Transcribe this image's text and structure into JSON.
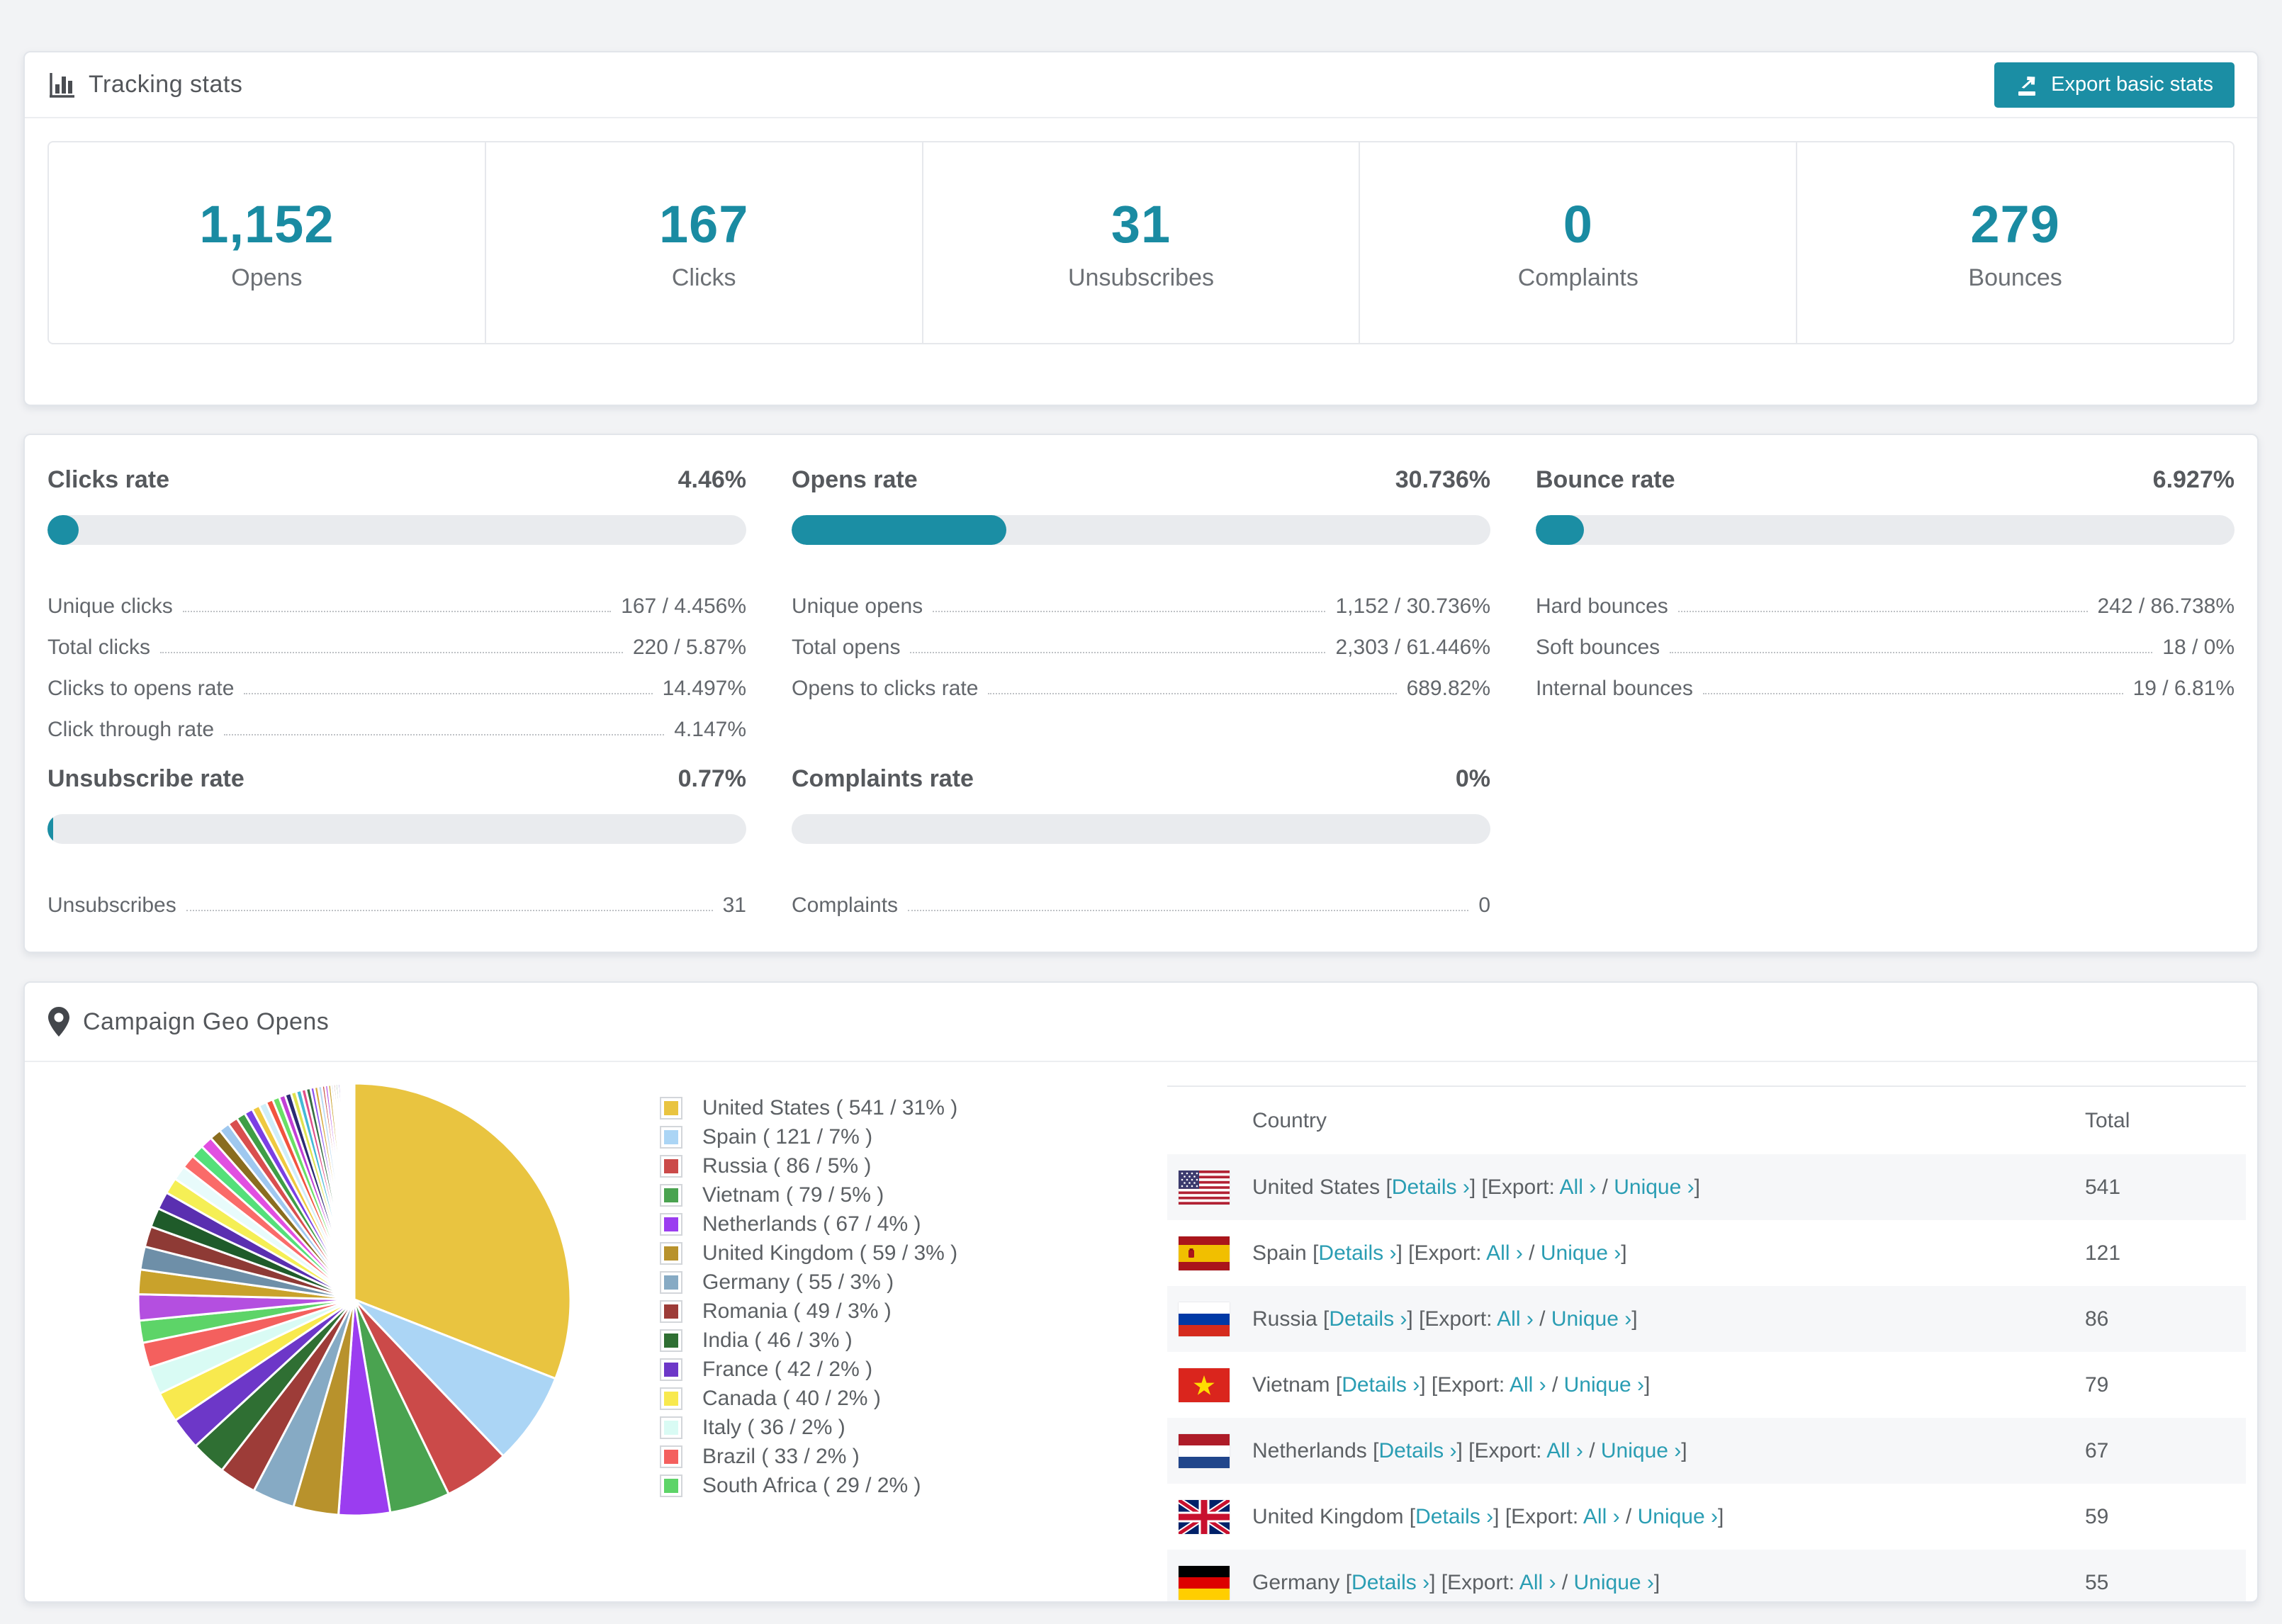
{
  "colors": {
    "accent_teal": "#1b8ea4",
    "number_teal": "#1a8ba2",
    "link_teal": "#2a9db3",
    "bar_track": "#e9ebee"
  },
  "tracking": {
    "title": "Tracking stats",
    "export_button": "Export basic stats",
    "stats": [
      {
        "value": "1,152",
        "label": "Opens"
      },
      {
        "value": "167",
        "label": "Clicks"
      },
      {
        "value": "31",
        "label": "Unsubscribes"
      },
      {
        "value": "0",
        "label": "Complaints"
      },
      {
        "value": "279",
        "label": "Bounces"
      }
    ]
  },
  "rates": {
    "cards": [
      {
        "title": "Clicks rate",
        "value": "4.46%",
        "percent": 4.46,
        "rows": [
          {
            "label": "Unique clicks",
            "value": "167 / 4.456%"
          },
          {
            "label": "Total clicks",
            "value": "220 / 5.87%"
          },
          {
            "label": "Clicks to opens rate",
            "value": "14.497%"
          },
          {
            "label": "Click through rate",
            "value": "4.147%"
          }
        ]
      },
      {
        "title": "Opens rate",
        "value": "30.736%",
        "percent": 30.736,
        "rows": [
          {
            "label": "Unique opens",
            "value": "1,152 / 30.736%"
          },
          {
            "label": "Total opens",
            "value": "2,303 / 61.446%"
          },
          {
            "label": "Opens to clicks rate",
            "value": "689.82%"
          }
        ]
      },
      {
        "title": "Bounce rate",
        "value": "6.927%",
        "percent": 6.927,
        "rows": [
          {
            "label": "Hard bounces",
            "value": "242 / 86.738%"
          },
          {
            "label": "Soft bounces",
            "value": "18 / 0%"
          },
          {
            "label": "Internal bounces",
            "value": "19 / 6.81%"
          }
        ]
      },
      {
        "title": "Unsubscribe rate",
        "value": "0.77%",
        "percent": 0.77,
        "rows": [
          {
            "label": "Unsubscribes",
            "value": "31"
          }
        ]
      },
      {
        "title": "Complaints rate",
        "value": "0%",
        "percent": 0,
        "rows": [
          {
            "label": "Complaints",
            "value": "0"
          }
        ]
      }
    ]
  },
  "geo": {
    "title": "Campaign Geo Opens",
    "table": {
      "headers": {
        "country": "Country",
        "total": "Total"
      },
      "link_details": "Details ›",
      "export_prefix": "[Export:",
      "link_all": "All ›",
      "slash": "/",
      "link_unique": "Unique ›",
      "bracket_open": "[",
      "bracket_close": "]",
      "rows": [
        {
          "country": "United States",
          "total": "541",
          "flag": "us"
        },
        {
          "country": "Spain",
          "total": "121",
          "flag": "es"
        },
        {
          "country": "Russia",
          "total": "86",
          "flag": "ru"
        },
        {
          "country": "Vietnam",
          "total": "79",
          "flag": "vn"
        },
        {
          "country": "Netherlands",
          "total": "67",
          "flag": "nl"
        },
        {
          "country": "United Kingdom",
          "total": "59",
          "flag": "gb"
        },
        {
          "country": "Germany",
          "total": "55",
          "flag": "de"
        }
      ]
    }
  },
  "chart_data": {
    "type": "pie",
    "title": "Campaign Geo Opens",
    "legend_position": "right",
    "start_angle_deg": -90,
    "direction": "clockwise",
    "series": [
      {
        "name": "United States",
        "value": 541,
        "pct": "31%",
        "color": "#e9c440",
        "legend": "United States ( 541 / 31% )"
      },
      {
        "name": "Spain",
        "value": 121,
        "pct": "7%",
        "color": "#abd5f5",
        "legend": "Spain ( 121 / 7% )"
      },
      {
        "name": "Russia",
        "value": 86,
        "pct": "5%",
        "color": "#cb4a49",
        "legend": "Russia ( 86 / 5% )"
      },
      {
        "name": "Vietnam",
        "value": 79,
        "pct": "5%",
        "color": "#4aa350",
        "legend": "Vietnam ( 79 / 5% )"
      },
      {
        "name": "Netherlands",
        "value": 67,
        "pct": "4%",
        "color": "#9b3df0",
        "legend": "Netherlands ( 67 / 4% )"
      },
      {
        "name": "United Kingdom",
        "value": 59,
        "pct": "3%",
        "color": "#b8922c",
        "legend": "United Kingdom ( 59 / 3% )"
      },
      {
        "name": "Germany",
        "value": 55,
        "pct": "3%",
        "color": "#86aac4",
        "legend": "Germany ( 55 / 3% )"
      },
      {
        "name": "Romania",
        "value": 49,
        "pct": "3%",
        "color": "#9d3c38",
        "legend": "Romania ( 49 / 3% )"
      },
      {
        "name": "India",
        "value": 46,
        "pct": "3%",
        "color": "#2f6f33",
        "legend": "India ( 46 / 3% )"
      },
      {
        "name": "France",
        "value": 42,
        "pct": "2%",
        "color": "#6d37c8",
        "legend": "France ( 42 / 2% )"
      },
      {
        "name": "Canada",
        "value": 40,
        "pct": "2%",
        "color": "#f8e94e",
        "legend": "Canada ( 40 / 2% )"
      },
      {
        "name": "Italy",
        "value": 36,
        "pct": "2%",
        "color": "#d9fbf4",
        "legend": "Italy ( 36 / 2% )"
      },
      {
        "name": "Brazil",
        "value": 33,
        "pct": "2%",
        "color": "#f4605e",
        "legend": "Brazil ( 33 / 2% )"
      },
      {
        "name": "South Africa",
        "value": 29,
        "pct": "2%",
        "color": "#5dd468",
        "legend": "South Africa ( 29 / 2% )"
      }
    ],
    "others_values": [
      34,
      32,
      30,
      27,
      25,
      23,
      21,
      19,
      18,
      17,
      16,
      15,
      14,
      13,
      12,
      11,
      10,
      10,
      9,
      9,
      8,
      8,
      7,
      7,
      6,
      6,
      5,
      5,
      5,
      4,
      4,
      4,
      3,
      3,
      3,
      3,
      2,
      2,
      2,
      2,
      2,
      2,
      1,
      1,
      1,
      1,
      1,
      1
    ],
    "others_palette": [
      "#b44fe0",
      "#c9a22b",
      "#6e8fa8",
      "#8e3a35",
      "#1f5b2a",
      "#5a2fb0",
      "#f5ef55",
      "#e8fbfb",
      "#fa6b69",
      "#54e07a",
      "#e14fe1",
      "#8a6d1f",
      "#9fc8ef",
      "#d94f4f",
      "#3f9e46",
      "#7b3fe4",
      "#efc93f",
      "#cfeef8",
      "#f2533f",
      "#6adf66",
      "#c13fd6",
      "#2b2b72",
      "#e0e24f",
      "#44b9d6",
      "#e04f8a",
      "#386e43",
      "#8d52f0",
      "#d6a93f",
      "#b9d9f2",
      "#c94f45"
    ]
  }
}
